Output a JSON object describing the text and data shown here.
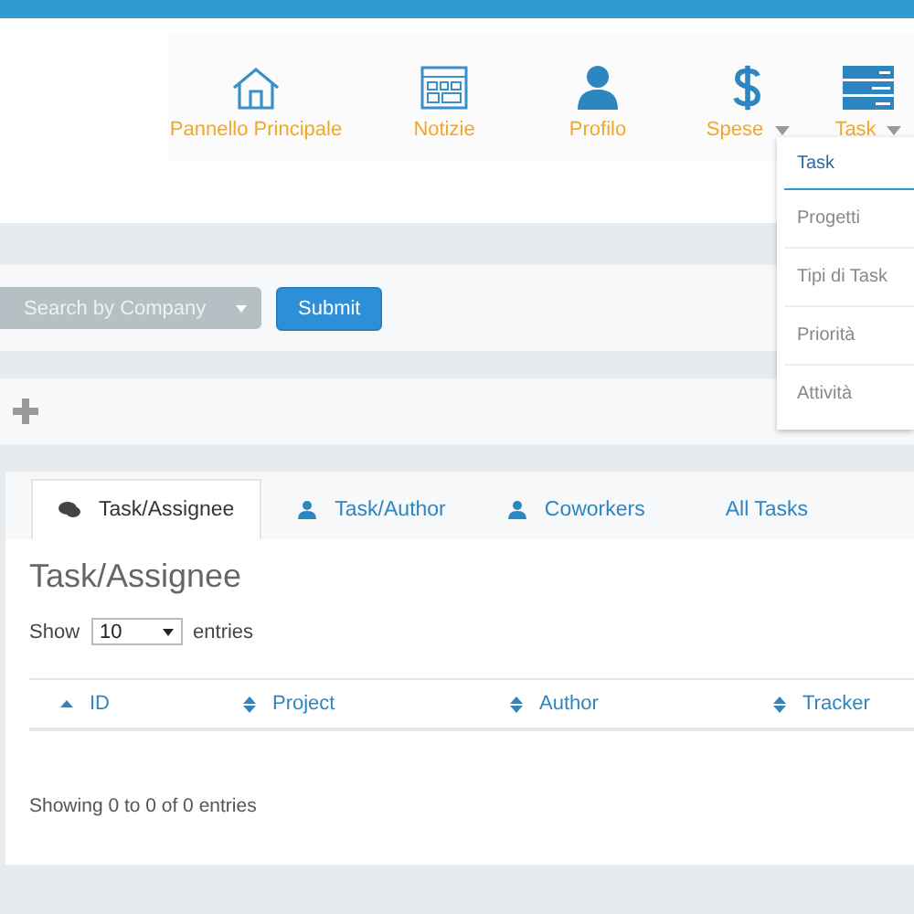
{
  "nav": [
    {
      "label": "Pannello Principale",
      "kind": "home",
      "dropdown": false
    },
    {
      "label": "Notizie",
      "kind": "news",
      "dropdown": false
    },
    {
      "label": "Profilo",
      "kind": "user",
      "dropdown": false
    },
    {
      "label": "Spese",
      "kind": "dollar",
      "dropdown": true
    },
    {
      "label": "Task",
      "kind": "list",
      "dropdown": true
    }
  ],
  "menu": [
    {
      "label": "Task",
      "selected": true
    },
    {
      "label": "Progetti",
      "selected": false
    },
    {
      "label": "Tipi di Task",
      "selected": false
    },
    {
      "label": "Priorità",
      "selected": false
    },
    {
      "label": "Attività",
      "selected": false
    }
  ],
  "filter": {
    "placeholder": "Search by Company",
    "button": "Submit"
  },
  "tabs": [
    {
      "label": "Task/Assignee",
      "kind": "chat",
      "selected": true
    },
    {
      "label": "Task/Author",
      "kind": "user",
      "selected": false
    },
    {
      "label": "Coworkers",
      "kind": "user",
      "selected": false
    },
    {
      "label": "All Tasks",
      "kind": "none",
      "selected": false
    }
  ],
  "panel": {
    "title": "Task/Assignee",
    "show": "Show",
    "entries_value": "10",
    "entries": "entries",
    "info": "Showing 0 to 0 of 0 entries"
  },
  "table": {
    "columns": [
      {
        "label": "ID",
        "sorted": true
      },
      {
        "label": "Project",
        "sorted": false
      },
      {
        "label": "Author",
        "sorted": false
      },
      {
        "label": "Tracker",
        "sorted": false
      }
    ]
  }
}
